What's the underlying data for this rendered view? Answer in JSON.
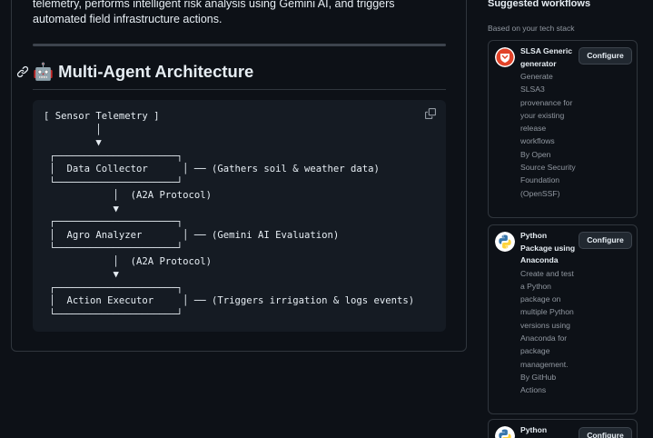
{
  "readme": {
    "intro_text": "telemetry, performs intelligent risk analysis using Gemini AI, and triggers automated field infrastructure actions.",
    "heading": "🤖 Multi-Agent Architecture",
    "code": "[ Sensor Telemetry ]\n         │\n         ▼\n ┌─────────────────────┐\n │  Data Collector      │ ── (Gathers soil & weather data)\n └─────────────────────┘\n            │  (A2A Protocol)\n            ▼\n ┌─────────────────────┐\n │  Agro Analyzer       │ ── (Gemini AI Evaluation)\n └─────────────────────┘\n            │  (A2A Protocol)\n            ▼\n ┌─────────────────────┐\n │  Action Executor     │ ── (Triggers irrigation & logs events)\n └─────────────────────┘"
  },
  "sidebar": {
    "title": "Suggested workflows",
    "subtitle": "Based on your tech stack",
    "cards": [
      {
        "icon": "openssf-shield-icon",
        "title": "SLSA Generic generator",
        "description": "Generate SLSA3 provenance for your existing release workflows",
        "author": "By Open Source Security Foundation (OpenSSF)",
        "button": "Configure"
      },
      {
        "icon": "python-icon",
        "title": "Python Package using Anaconda",
        "description": "Create and test a Python package on multiple Python versions using Anaconda for package management.",
        "author": "By GitHub Actions",
        "button": "Configure"
      },
      {
        "icon": "python-icon",
        "title": "Python",
        "description": "",
        "author": "",
        "button": "Configure"
      }
    ]
  },
  "colors": {
    "background": "#0d1117",
    "border": "#30363d",
    "muted_text": "#9198a1",
    "openssf_red": "#e24329",
    "python_blue": "#3776ab",
    "python_yellow": "#ffd43b"
  }
}
